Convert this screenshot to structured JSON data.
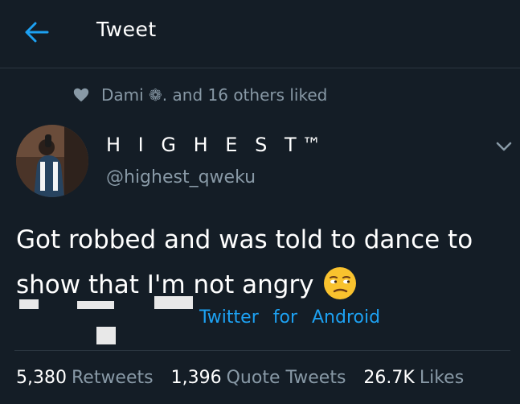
{
  "header": {
    "title": "Tweet",
    "back_icon": "arrow-left-icon",
    "accent_color": "#1da1f2"
  },
  "social_context": {
    "icon": "heart-icon",
    "text": "Dami ❁. and 16 others liked"
  },
  "author": {
    "display_name": "H I G H E S T™",
    "handle": "@highest_qweku"
  },
  "tweet": {
    "text": "Got robbed and was told to dance to show that I'm not angry",
    "emoji": "unamused-face"
  },
  "source": {
    "prefix": "Twitter",
    "connector": "for",
    "platform": "Android"
  },
  "stats": [
    {
      "value": "5,380",
      "label": "Retweets"
    },
    {
      "value": "1,396",
      "label": "Quote Tweets"
    },
    {
      "value": "26.7K",
      "label": "Likes"
    }
  ]
}
